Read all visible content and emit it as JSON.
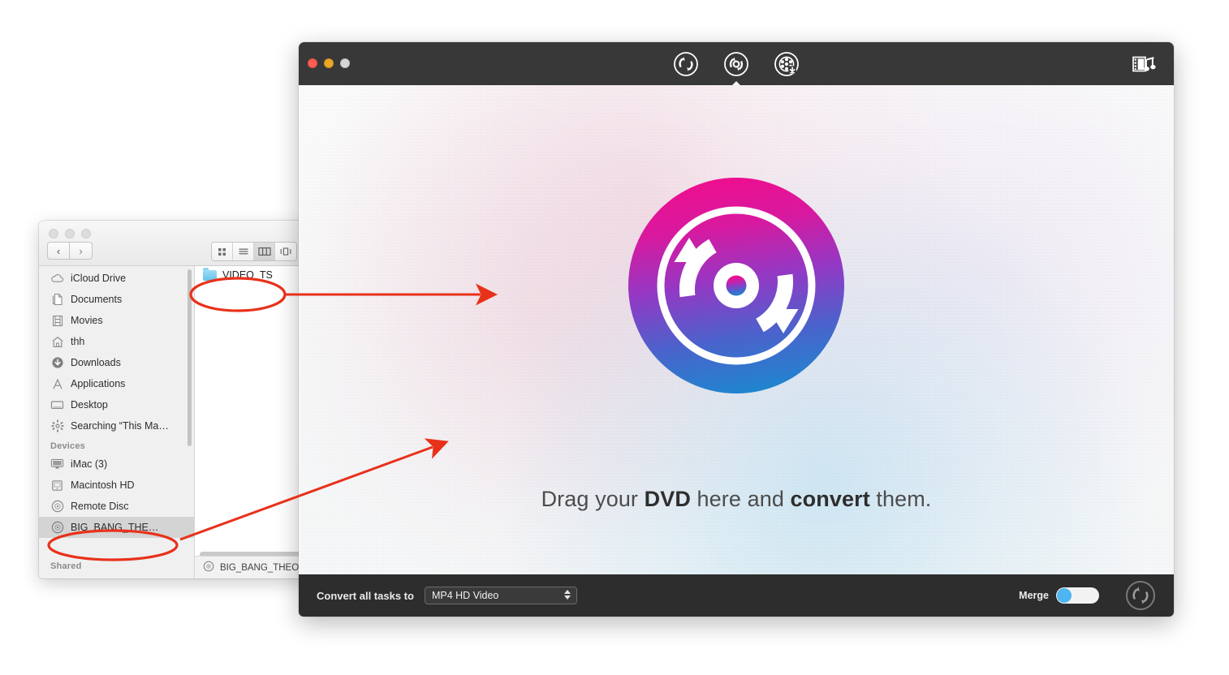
{
  "finder": {
    "window_name": "finder-window",
    "toolbar": {
      "back_label": "‹",
      "forward_label": "›",
      "view_modes": [
        "icon-view",
        "list-view",
        "column-view",
        "coverflow-view"
      ],
      "selected_view": "column-view"
    },
    "sidebar": {
      "favorites": [
        {
          "label": "iCloud Drive",
          "icon": "icloud-icon"
        },
        {
          "label": "Documents",
          "icon": "documents-icon"
        },
        {
          "label": "Movies",
          "icon": "movies-icon"
        },
        {
          "label": "thh",
          "icon": "home-icon"
        },
        {
          "label": "Downloads",
          "icon": "downloads-icon"
        },
        {
          "label": "Applications",
          "icon": "applications-icon"
        },
        {
          "label": "Desktop",
          "icon": "desktop-icon"
        },
        {
          "label": "Searching “This Ma…",
          "icon": "gear-icon"
        }
      ],
      "devices_header": "Devices",
      "devices": [
        {
          "label": "iMac (3)",
          "icon": "imac-icon",
          "selected": false
        },
        {
          "label": "Macintosh HD",
          "icon": "harddisk-icon",
          "selected": false
        },
        {
          "label": "Remote Disc",
          "icon": "disc-icon",
          "selected": false
        },
        {
          "label": "BIG_BANG_THE…",
          "icon": "disc-icon",
          "selected": true
        }
      ],
      "shared_header": "Shared"
    },
    "files": [
      {
        "label": "VIDEO_TS",
        "icon": "folder-icon"
      }
    ],
    "pathbar": {
      "label": "BIG_BANG_THEOR",
      "icon": "disc-icon"
    }
  },
  "app": {
    "window_name": "dvd-converter-window",
    "titlebar": {
      "traffic_lights": [
        "close",
        "minimize",
        "zoom"
      ],
      "tabs": [
        {
          "name": "convert-tab",
          "icon": "convert-arrows-icon",
          "active": false
        },
        {
          "name": "dvd-ripper-tab",
          "icon": "dvd-rip-icon",
          "active": true
        },
        {
          "name": "download-tab",
          "icon": "film-download-icon",
          "active": false
        }
      ],
      "library_button": {
        "name": "media-library-button",
        "icon": "film-music-icon"
      }
    },
    "main": {
      "logo": "dvd-converter-logo",
      "drop_text_prefix": "Drag your ",
      "drop_text_bold1": "DVD",
      "drop_text_middle": " here and ",
      "drop_text_bold2": "convert",
      "drop_text_suffix": " them."
    },
    "footer": {
      "convert_all_label": "Convert all tasks to",
      "format_value": "MP4 HD Video",
      "merge_label": "Merge",
      "merge_on": true,
      "convert_button": "convert-start-button"
    }
  },
  "annotations": {
    "color": "#E8311A",
    "items": [
      {
        "name": "ellipse-video-ts",
        "shape": "ellipse"
      },
      {
        "name": "ellipse-big-bang-device",
        "shape": "ellipse"
      },
      {
        "name": "arrow-video-ts-to-app",
        "shape": "arrow"
      },
      {
        "name": "arrow-device-to-app",
        "shape": "arrow"
      }
    ]
  },
  "colors": {
    "accent_pink": "#E0189B",
    "accent_purple": "#8E38C6",
    "accent_blue": "#1E79C9",
    "toggle_blue": "#4DB5F0",
    "titlebar_dark": "#383838",
    "footer_dark": "#2D2D2D",
    "annotation_red": "#E8311A"
  }
}
